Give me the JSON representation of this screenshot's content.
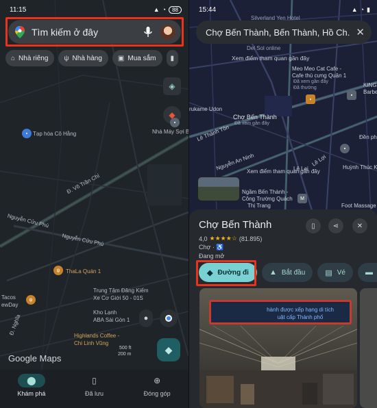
{
  "left": {
    "status": {
      "time": "11:15",
      "battery": "88"
    },
    "search": {
      "placeholder": "Tìm kiếm ở đây"
    },
    "chips": [
      {
        "icon": "home-icon",
        "label": "Nhà riêng"
      },
      {
        "icon": "restaurant-icon",
        "label": "Nhà hàng"
      },
      {
        "icon": "shopping-icon",
        "label": "Mua sắm"
      }
    ],
    "map_labels": {
      "place1": "Tạp hóa Cô Hằng",
      "place2": "Nhà Máy Sợi Bông",
      "road1": "Đ. Võ Trần Chí",
      "road2": "Nguyễn Cửu Phú",
      "road3": "Nguyễn Cửu Phú",
      "place3": "ThaLa Quán 1",
      "place4": "Trung Tâm Đăng Kiểm",
      "place4b": "Xe Cơ Giới 50 - 01S",
      "place5": "Kho Lạnh",
      "place5b": "ABA Sài Gòn 1",
      "place6": "Highlands Coffee -",
      "place6b": "Chi Linh Vũng",
      "place7": "Tacos",
      "place7b": "ewDay",
      "road4": "Đ. Nghĩa"
    },
    "logo": "Google Maps",
    "scale": {
      "ft": "500 ft",
      "m": "200 m"
    },
    "tabs": [
      {
        "label": "Khám phá"
      },
      {
        "label": "Đã lưu"
      },
      {
        "label": "Đóng góp"
      }
    ]
  },
  "right": {
    "status": {
      "time": "15:44"
    },
    "search": {
      "value": "Chợ Bến Thành, Bến Thành, Hồ Ch..."
    },
    "map_labels": {
      "top1": "Silverland Yen Hotel",
      "top2": "Del Sol online",
      "nearby": "Xem điểm tham quan gần đây",
      "cafe1": "Meo Meo Cat Cafe -",
      "cafe2": "Cafe thú cưng Quận 1",
      "cafe3": "Đã xem gần đây",
      "cafe4": "Đã thường",
      "place1": "rukame Udon",
      "market": "Chợ Bến Thành",
      "market_sub": "Đã xem gần đây",
      "road1": "Lê Thánh Tôn",
      "road2": "Nguyễn An Ninh",
      "road3": "Lê Lai",
      "road4": "Lê Lợi",
      "nearby2": "Xem điểm tham quan gần đây",
      "place2": "Ngầm Bến Thành -",
      "place2b": "Công Trường Quách",
      "place2c": "Thị Trang",
      "place3": "Huỳnh Thúc K",
      "place4": "KING",
      "place4b": "Barbe",
      "place5": "Foot Massage",
      "place6": "Đền phúc"
    },
    "place": {
      "title": "Chợ Bến Thành",
      "rating": "4,0",
      "stars": "★★★★☆",
      "reviews": "(81.895)",
      "category": "Chợ ·",
      "status": "Đang mở"
    },
    "actions": [
      {
        "icon": "directions-icon",
        "label": "Đường đi"
      },
      {
        "icon": "navigation-icon",
        "label": "Bắt đầu"
      },
      {
        "icon": "ticket-icon",
        "label": "Vé"
      },
      {
        "icon": "bed-icon",
        "label": ""
      }
    ],
    "photo_banner": "hành được xếp hạng di tích\nuật cấp Thành phố"
  },
  "colors": {
    "highlight": "#e8341c",
    "accent": "#79d1d3",
    "map_left": "#1f2429",
    "map_right": "#1b2036",
    "pin_red": "#e8543a"
  }
}
